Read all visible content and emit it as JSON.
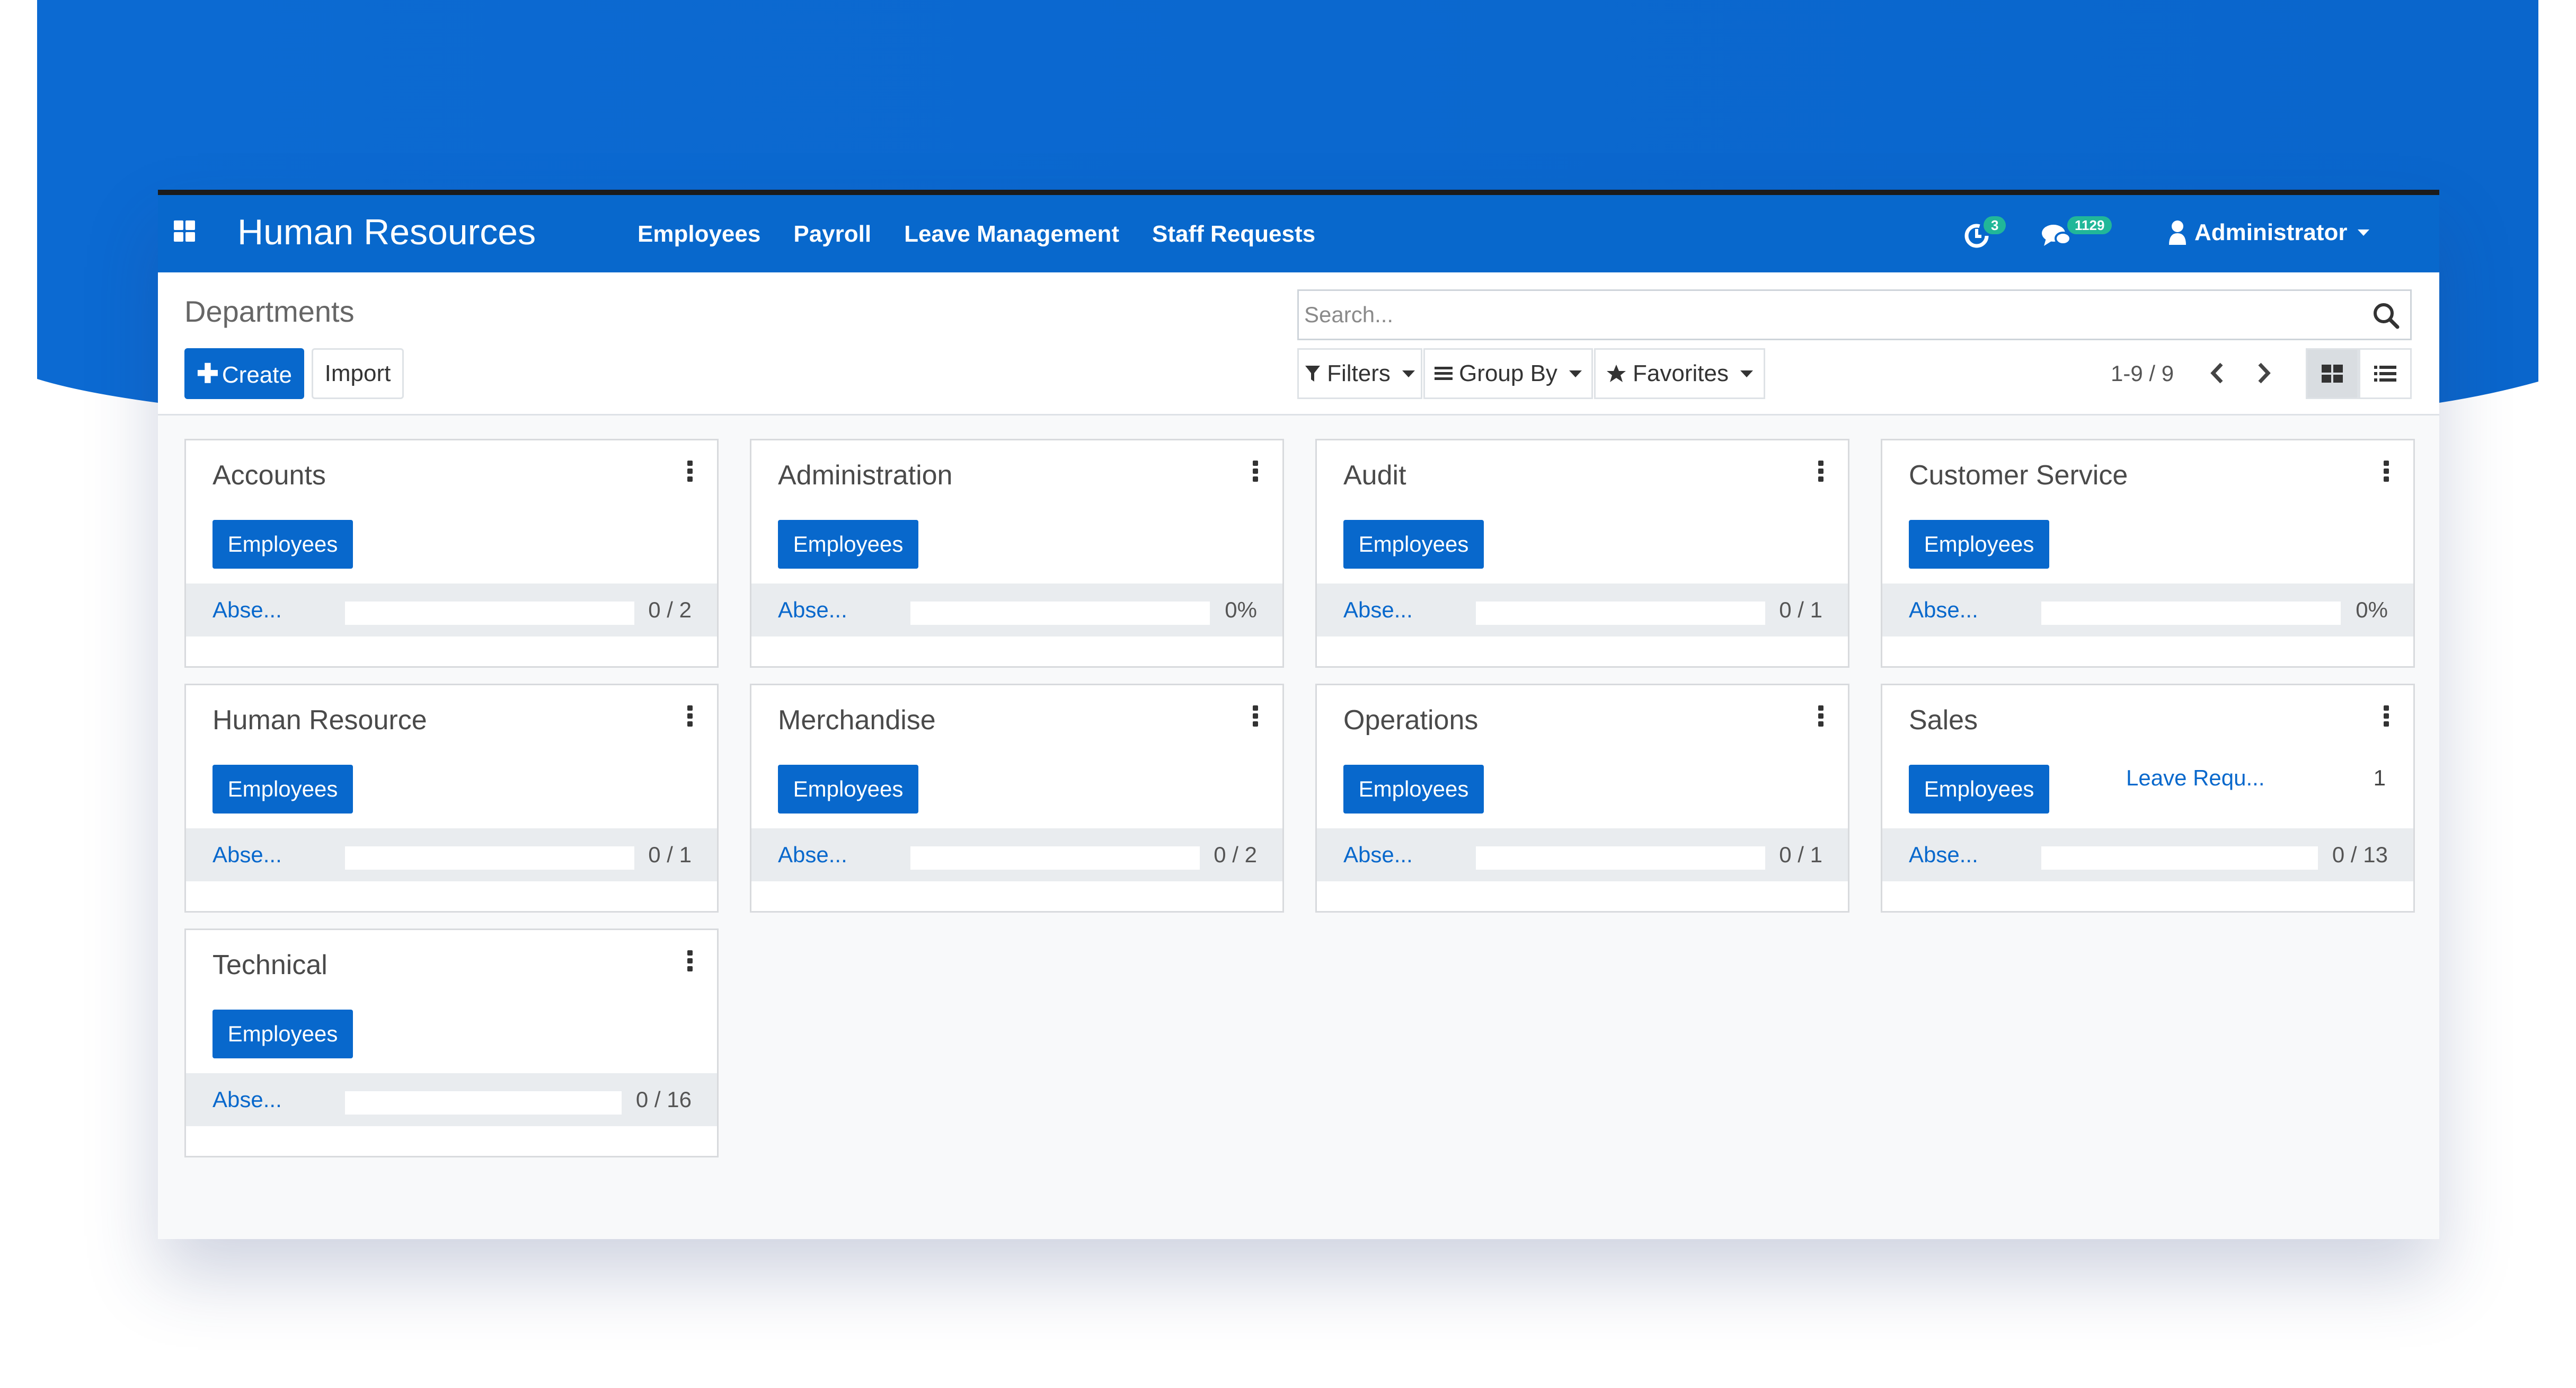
{
  "colors": {
    "primary": "#0868cc",
    "badge": "#21b799",
    "background_band": "#0a6ad3"
  },
  "navbar": {
    "app_title": "Human Resources",
    "menu": [
      "Employees",
      "Payroll",
      "Leave Management",
      "Staff Requests"
    ],
    "activity_badge": "3",
    "messages_badge": "1129",
    "user_name": "Administrator",
    "icons": [
      "apps-grid-icon",
      "activity-clock-icon",
      "chat-bubbles-icon",
      "user-icon",
      "caret-down-icon"
    ]
  },
  "control_panel": {
    "breadcrumb": "Departments",
    "create_label": "Create",
    "import_label": "Import",
    "search_placeholder": "Search...",
    "filters_label": "Filters",
    "group_by_label": "Group By",
    "favorites_label": "Favorites",
    "pager": "1-9 / 9",
    "active_view": "kanban"
  },
  "departments": [
    {
      "name": "Accounts",
      "button": "Employees",
      "footer_link": "Abse...",
      "footer_value": "0 / 2",
      "progress": 0
    },
    {
      "name": "Administration",
      "button": "Employees",
      "footer_link": "Abse...",
      "footer_value": "0%",
      "progress": 0
    },
    {
      "name": "Audit",
      "button": "Employees",
      "footer_link": "Abse...",
      "footer_value": "0 / 1",
      "progress": 0
    },
    {
      "name": "Customer Service",
      "button": "Employees",
      "footer_link": "Abse...",
      "footer_value": "0%",
      "progress": 0
    },
    {
      "name": "Human Resource",
      "button": "Employees",
      "footer_link": "Abse...",
      "footer_value": "0 / 1",
      "progress": 0
    },
    {
      "name": "Merchandise",
      "button": "Employees",
      "footer_link": "Abse...",
      "footer_value": "0 / 2",
      "progress": 0
    },
    {
      "name": "Operations",
      "button": "Employees",
      "footer_link": "Abse...",
      "footer_value": "0 / 1",
      "progress": 0
    },
    {
      "name": "Sales",
      "button": "Employees",
      "footer_link": "Abse...",
      "footer_value": "0 / 13",
      "progress": 0,
      "extra_link": "Leave Requ...",
      "extra_value": "1"
    },
    {
      "name": "Technical",
      "button": "Employees",
      "footer_link": "Abse...",
      "footer_value": "0 / 16",
      "progress": 0
    }
  ]
}
